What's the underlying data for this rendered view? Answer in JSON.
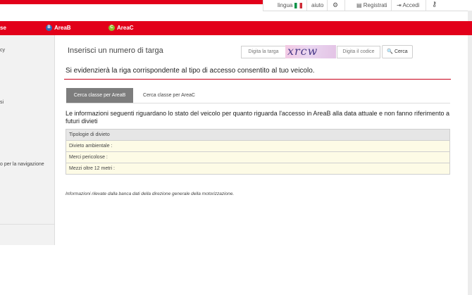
{
  "utility_bar": {
    "lingua": "lingua",
    "aiuto": "aiuto",
    "registrati": "Registrati",
    "accedi": "Accedi",
    "icons": [
      "italy-flag-icon",
      "gear-icon",
      "register-icon",
      "login-icon",
      "key-icon"
    ]
  },
  "nav": {
    "items": [
      "se",
      "AreaB",
      "AreaC"
    ],
    "badges": [
      "B",
      "C"
    ],
    "colors": {
      "bar": "#e2001a",
      "areab_badge": "#2d6bb5",
      "areac_badge": "#8cbf26"
    }
  },
  "sidebar": {
    "items": [
      "cy",
      "si",
      "o per la navigazione"
    ]
  },
  "form": {
    "title": "Inserisci un numero di targa",
    "plate_placeholder": "Digita la targa",
    "captcha_text": "xrcw",
    "code_placeholder": "Digita il codice",
    "search_label": "Cerca"
  },
  "info_line": "Si evidenzierà la riga corrispondente al tipo di accesso consentito al tuo veicolo.",
  "tabs": [
    "Cerca classe per AreaB",
    "Cerca classe per AreaC"
  ],
  "description": "Le informazioni seguenti riguardano lo stato del veicolo per quanto riguarda l'accesso in AreaB alla data attuale e non fanno riferimento a futuri divieti",
  "table": {
    "header": "Tipologie di divieto",
    "rows": [
      "Divieto ambientale :",
      "Merci pericolose :",
      "Mezzi oltre 12 metri :"
    ]
  },
  "footnote": "Informazioni rilevate dalla banca dati della direzione generale della motorizzazione."
}
